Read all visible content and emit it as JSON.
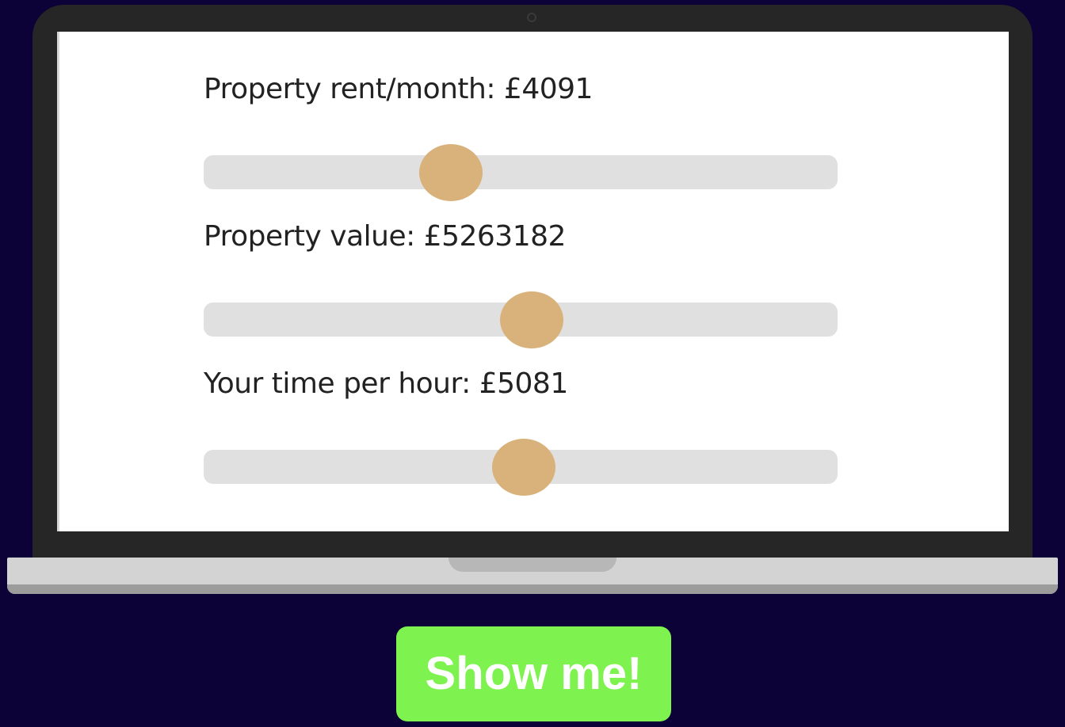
{
  "colors": {
    "background": "#0d0238",
    "laptop_bezel": "#262626",
    "screen": "#ffffff",
    "slider_track": "#e0e0e0",
    "slider_thumb": "#d8b27a",
    "button": "#7ef24f",
    "button_text": "#ffffff"
  },
  "sliders": [
    {
      "label": "Property rent/month: £4091",
      "position": 0.39
    },
    {
      "label": "Property value: £5263182",
      "position": 0.518
    },
    {
      "label": "Your time per hour: £5081",
      "position": 0.505
    }
  ],
  "cta": {
    "label": "Show me!"
  }
}
